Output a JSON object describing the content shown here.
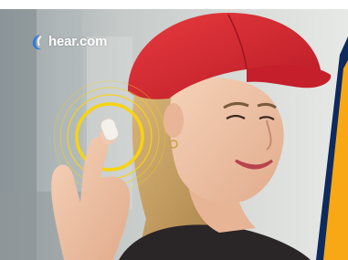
{
  "brand": {
    "name": "hear.com",
    "logo_icon": "arc-swoosh-icon"
  },
  "colors": {
    "ring_yellow": "#F6D410",
    "accent_orange": "#F8A815",
    "accent_navy": "#0E2A5E",
    "cap_red": "#D8232F",
    "logo_arc_blue": "#2E7BD6"
  }
}
